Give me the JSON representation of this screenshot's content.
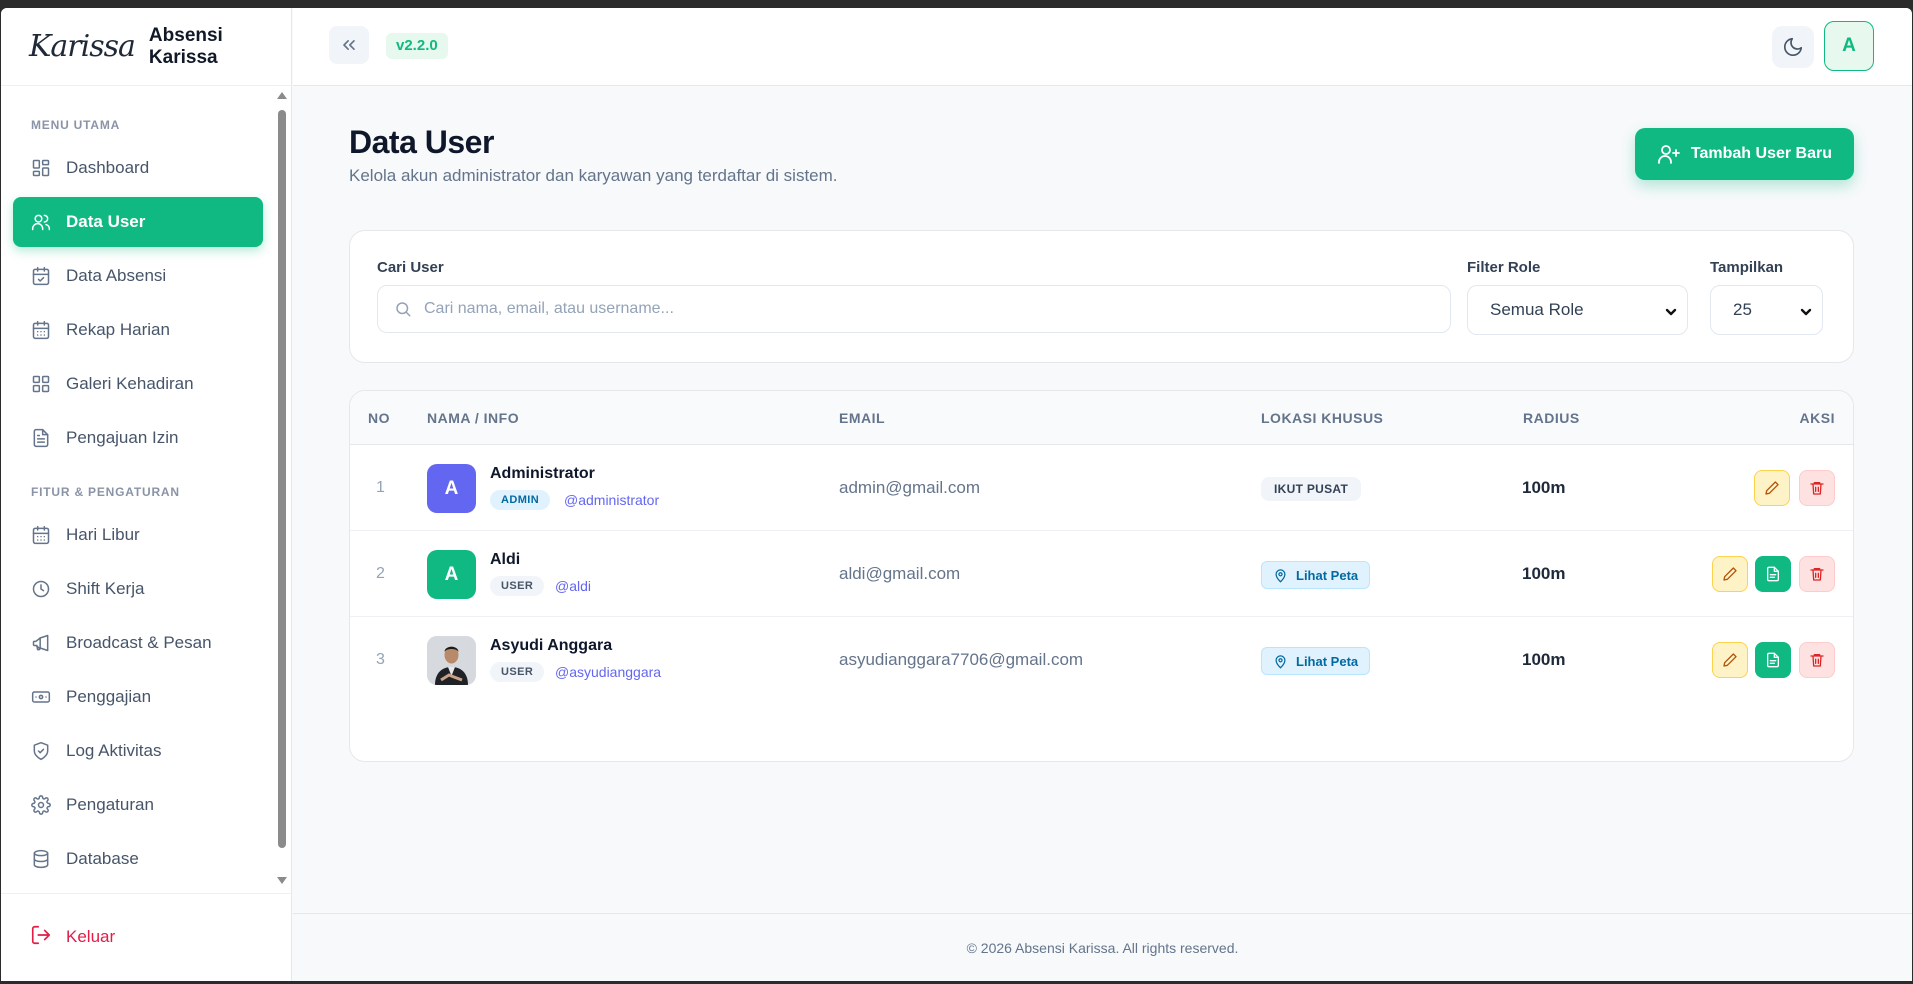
{
  "brand": {
    "logo_text": "Karissa",
    "title": "Absensi Karissa"
  },
  "header": {
    "version": "v2.2.0",
    "avatar_initial": "A"
  },
  "sidebar": {
    "sections": [
      {
        "label": "MENU UTAMA",
        "items": [
          {
            "label": "Dashboard",
            "icon": "grid-icon",
            "active": false
          },
          {
            "label": "Data User",
            "icon": "users-icon",
            "active": true
          },
          {
            "label": "Data Absensi",
            "icon": "calendar-check-icon",
            "active": false
          },
          {
            "label": "Rekap Harian",
            "icon": "calendar-icon",
            "active": false
          },
          {
            "label": "Galeri Kehadiran",
            "icon": "grid-icon",
            "active": false
          },
          {
            "label": "Pengajuan Izin",
            "icon": "document-icon",
            "active": false
          }
        ]
      },
      {
        "label": "FITUR & PENGATURAN",
        "items": [
          {
            "label": "Hari Libur",
            "icon": "calendar-icon",
            "active": false
          },
          {
            "label": "Shift Kerja",
            "icon": "clock-icon",
            "active": false
          },
          {
            "label": "Broadcast & Pesan",
            "icon": "megaphone-icon",
            "active": false
          },
          {
            "label": "Penggajian",
            "icon": "banknote-icon",
            "active": false
          },
          {
            "label": "Log Aktivitas",
            "icon": "shield-icon",
            "active": false
          },
          {
            "label": "Pengaturan",
            "icon": "gear-icon",
            "active": false
          },
          {
            "label": "Database",
            "icon": "database-icon",
            "active": false
          }
        ]
      }
    ],
    "logout_label": "Keluar"
  },
  "page": {
    "title": "Data User",
    "subtitle": "Kelola akun administrator dan karyawan yang terdaftar di sistem.",
    "add_button_label": "Tambah User Baru"
  },
  "filters": {
    "search_label": "Cari User",
    "search_placeholder": "Cari nama, email, atau username...",
    "search_value": "",
    "role_label": "Filter Role",
    "role_value": "Semua Role",
    "show_label": "Tampilkan",
    "show_value": "25"
  },
  "table": {
    "columns": [
      "NO",
      "NAMA / INFO",
      "EMAIL",
      "LOKASI KHUSUS",
      "RADIUS",
      "AKSI"
    ],
    "rows": [
      {
        "no": "1",
        "avatar": "A",
        "avatar_color": "#6366f1",
        "name": "Administrator",
        "role": "ADMIN",
        "username": "@administrator",
        "email": "admin@gmail.com",
        "lokasi": "IKUT PUSAT",
        "radius": "100m",
        "actions": [
          "edit",
          "delete"
        ]
      },
      {
        "no": "2",
        "avatar": "A",
        "avatar_color": "#10b981",
        "name": "Aldi",
        "role": "USER",
        "username": "@aldi",
        "email": "aldi@gmail.com",
        "lokasi": "Lihat Peta",
        "radius": "100m",
        "actions": [
          "edit",
          "document",
          "delete"
        ]
      },
      {
        "no": "3",
        "avatar": "photo",
        "avatar_color": "#cfd4da",
        "name": "Asyudi Anggara",
        "role": "USER",
        "username": "@asyudianggara",
        "email": "asyudianggara7706@gmail.com",
        "lokasi": "Lihat Peta",
        "radius": "100m",
        "actions": [
          "edit",
          "document",
          "delete"
        ]
      }
    ]
  },
  "footer": {
    "text": "© 2026 Absensi Karissa. All rights reserved."
  },
  "colors": {
    "accent": "#10b981",
    "admin_badge_bg": "#e0f2fe",
    "admin_badge_fg": "#0369a1",
    "user_badge_bg": "#f1f5f9",
    "user_badge_fg": "#475569"
  }
}
